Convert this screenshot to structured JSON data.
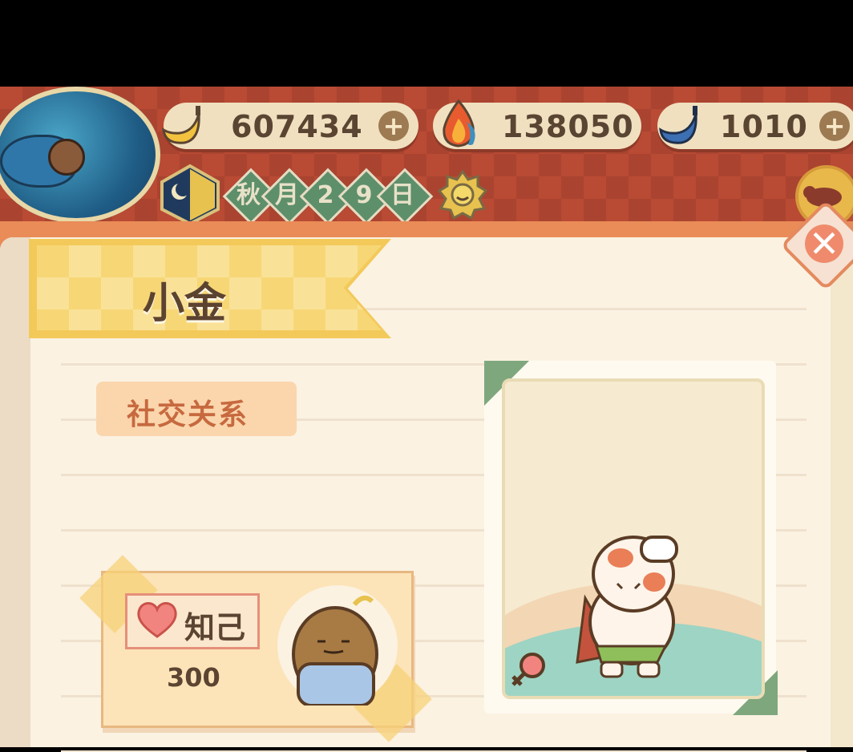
{
  "currencies": [
    {
      "name": "banana",
      "value": "607434",
      "icon": "banana-icon",
      "color": "#f2c23e"
    },
    {
      "name": "fire",
      "value": "138050",
      "icon": "flame-icon",
      "color": "#e85b2f"
    },
    {
      "name": "blue-banana",
      "value": "1010",
      "icon": "blue-banana-icon",
      "color": "#3d6fb3"
    }
  ],
  "add_symbol": "+",
  "date": {
    "chars": [
      "秋",
      "月",
      "2",
      "9",
      "日"
    ]
  },
  "character": {
    "name": "小金",
    "section_label": "社交关系",
    "relation": {
      "label": "知己",
      "value": "300"
    },
    "gender_icon": "female-icon"
  },
  "close_symbol": "✕",
  "colors": {
    "accent": "#e98c58",
    "banner": "#f3c95a",
    "page": "#fbf2e2",
    "text": "#5c4432"
  }
}
